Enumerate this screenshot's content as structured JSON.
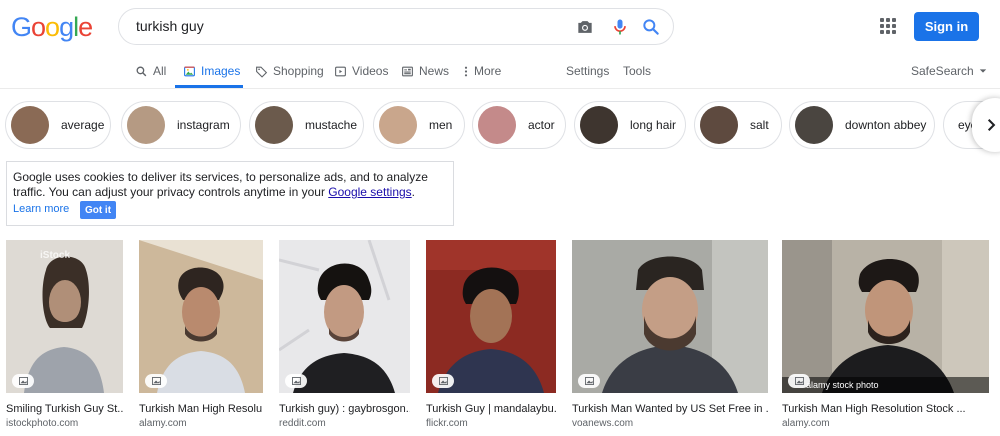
{
  "header": {
    "logo_letters": [
      "G",
      "o",
      "o",
      "g",
      "l",
      "e"
    ],
    "search_value": "turkish guy",
    "signin_label": "Sign in"
  },
  "tabs": {
    "all": "All",
    "images": "Images",
    "shopping": "Shopping",
    "videos": "Videos",
    "news": "News",
    "more": "More",
    "settings": "Settings",
    "tools": "Tools",
    "safesearch": "SafeSearch"
  },
  "chips": [
    {
      "label": "average",
      "color": "#8a6a55"
    },
    {
      "label": "instagram",
      "color": "#b59a83"
    },
    {
      "label": "mustache",
      "color": "#6b5a4c"
    },
    {
      "label": "men",
      "color": "#c9a68c"
    },
    {
      "label": "actor",
      "color": "#c48a8a"
    },
    {
      "label": "long hair",
      "color": "#3e352f"
    },
    {
      "label": "salt",
      "color": "#5e4a3f"
    },
    {
      "label": "downton abbey",
      "color": "#4a4540"
    },
    {
      "label": "eye",
      "color": "#ffffff"
    }
  ],
  "cookie": {
    "text_before": "Google uses cookies to deliver its services, to personalize ads, and to analyze traffic. You can adjust your privacy controls anytime in your ",
    "link": "Google settings",
    "text_after": ".",
    "learn_more": "Learn more",
    "got_it": "Got it"
  },
  "results": [
    {
      "caption": "Smiling Turkish Guy St...",
      "source": "istockphoto.com",
      "watermark": "iStock",
      "bg": "#d9d5d0",
      "skin": "#b08f78",
      "hair": "#3b2f27",
      "shirt": "#9aa0a8"
    },
    {
      "caption": "Turkish Man High Resolu...",
      "source": "alamy.com",
      "watermark": "",
      "bg": "#c9b59a",
      "skin": "#b98a6e",
      "hair": "#2e2520",
      "shirt": "#d8dde5"
    },
    {
      "caption": "Turkish guy) : gaybrosgon...",
      "source": "reddit.com",
      "watermark": "",
      "bg": "#e6e6e8",
      "skin": "#c29a82",
      "hair": "#151210",
      "shirt": "#1f1f22"
    },
    {
      "caption": "Turkish Guy | mandalaybu...",
      "source": "flickr.com",
      "watermark": "",
      "bg": "#8c2a22",
      "skin": "#a37356",
      "hair": "#141010",
      "shirt": "#2f3550"
    },
    {
      "caption": "Turkish Man Wanted by US Set Free in ...",
      "source": "voanews.com",
      "watermark": "",
      "bg": "#a7a8a3",
      "skin": "#c49e86",
      "hair": "#2a2521",
      "shirt": "#3a3d45"
    },
    {
      "caption": "Turkish Man High Resolution Stock ...",
      "source": "alamy.com",
      "watermark": "alamy stock photo",
      "bg": "#b8b2a6",
      "skin": "#c0957a",
      "hair": "#1d1816",
      "shirt": "#1c1c1e"
    }
  ]
}
